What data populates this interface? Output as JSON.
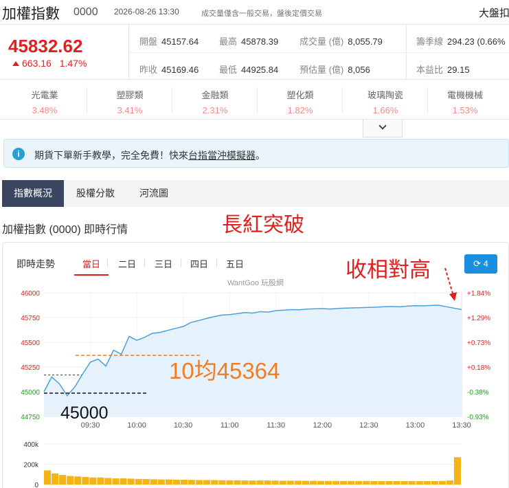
{
  "header": {
    "title": "加權指數",
    "code": "0000",
    "datetime": "2026-08-26 13:30",
    "note": "成交量僅含一般交易，盤後定價交易",
    "market": "大盤扣"
  },
  "quote": {
    "price": "45832.62",
    "change": "663.16",
    "change_pct": "1.47%",
    "open_label": "開盤",
    "open": "45157.64",
    "high_label": "最高",
    "high": "45878.39",
    "volume_label": "成交量 (億)",
    "volume": "8,055.79",
    "ma_label": "籌季線",
    "ma": "294.23 (0.66%",
    "prev_label": "昨收",
    "prev": "45169.46",
    "low_label": "最低",
    "low": "44925.84",
    "est_label": "預估量 (億)",
    "est": "8,056",
    "pe_label": "本益比",
    "pe": "29.15"
  },
  "sectors": [
    {
      "name": "光電業",
      "pct": "3.48%"
    },
    {
      "name": "塑膠類",
      "pct": "3.41%"
    },
    {
      "name": "金融類",
      "pct": "2.31%"
    },
    {
      "name": "塑化類",
      "pct": "1.82%"
    },
    {
      "name": "玻璃陶瓷",
      "pct": "1.66%"
    },
    {
      "name": "電機機械",
      "pct": "1.53%"
    }
  ],
  "tip": {
    "icon": "i",
    "text_before": "期貨下單新手教學，完全免費！快來",
    "link": "台指當沖模擬器",
    "text_after": "。"
  },
  "tabs": [
    "指數概況",
    "股權分散",
    "河流圖"
  ],
  "section_title": "加權指數 (0000) 即時行情",
  "annotation_title": "長紅突破",
  "panel": {
    "label": "即時走勢",
    "ranges": [
      "當日",
      "二日",
      "三日",
      "四日",
      "五日"
    ],
    "refresh_count": "4"
  },
  "chart_data": {
    "type": "line",
    "watermark": "WantGoo 玩股網",
    "x_ticks": [
      "09:30",
      "10:00",
      "10:30",
      "11:00",
      "11:30",
      "12:00",
      "12:30",
      "13:00",
      "13:30"
    ],
    "y_left_ticks": [
      "46000",
      "45750",
      "45500",
      "45250",
      "45000",
      "44750"
    ],
    "y_right_ticks": [
      "+1.84%",
      "+1.29%",
      "+0.73%",
      "+0.18%",
      "-0.38%",
      "-0.93%"
    ],
    "ylim": [
      44750,
      46000
    ],
    "reference": 45169.46,
    "series": [
      {
        "x": [
          "09:00",
          "09:05",
          "09:10",
          "09:15",
          "09:20",
          "09:25",
          "09:30",
          "09:35",
          "09:40",
          "09:45",
          "09:50",
          "09:55",
          "10:00",
          "10:05",
          "10:10",
          "10:15",
          "10:20",
          "10:25",
          "10:30",
          "10:35",
          "10:40",
          "10:45",
          "10:50",
          "10:55",
          "11:00",
          "11:05",
          "11:10",
          "11:15",
          "11:20",
          "11:25",
          "11:30",
          "11:35",
          "11:40",
          "11:45",
          "11:50",
          "11:55",
          "12:00",
          "12:05",
          "12:10",
          "12:15",
          "12:20",
          "12:25",
          "12:30",
          "12:35",
          "12:40",
          "12:45",
          "12:50",
          "12:55",
          "13:00",
          "13:05",
          "13:10",
          "13:15",
          "13:20",
          "13:25",
          "13:30"
        ],
        "y": [
          45000,
          45150,
          45080,
          44960,
          45050,
          45180,
          45300,
          45330,
          45260,
          45420,
          45380,
          45560,
          45520,
          45550,
          45590,
          45600,
          45620,
          45640,
          45660,
          45700,
          45720,
          45740,
          45760,
          45775,
          45780,
          45790,
          45800,
          45795,
          45810,
          45805,
          45820,
          45825,
          45830,
          45828,
          45835,
          45838,
          45840,
          45836,
          45842,
          45845,
          45848,
          45850,
          45852,
          45855,
          45860,
          45862,
          45858,
          45865,
          45870,
          45868,
          45872,
          45875,
          45860,
          45845,
          45832
        ]
      }
    ],
    "volume": {
      "y_ticks": [
        "400k",
        "200k",
        "0"
      ],
      "ylim": [
        0,
        400000
      ],
      "values": [
        140000,
        110000,
        95000,
        85000,
        80000,
        75000,
        70000,
        70000,
        65000,
        60000,
        62000,
        58000,
        55000,
        55000,
        52000,
        50000,
        50000,
        48000,
        48000,
        46000,
        45000,
        45000,
        44000,
        43000,
        42000,
        42000,
        41000,
        40000,
        40000,
        40000,
        39000,
        38000,
        38000,
        38000,
        37000,
        37000,
        36000,
        36000,
        36000,
        35000,
        35000,
        35000,
        35000,
        34000,
        34000,
        34000,
        34000,
        34000,
        33000,
        33000,
        33000,
        34000,
        36000,
        40000,
        270000
      ]
    },
    "annotations": {
      "open_level": "45000",
      "ma10": "10均45364",
      "high_note": "收相對高"
    }
  },
  "colors": {
    "up": "#e02020",
    "down": "#1aa31a",
    "line": "#4aa0dc",
    "volume": "#f5b416",
    "ma": "#f07d23"
  }
}
